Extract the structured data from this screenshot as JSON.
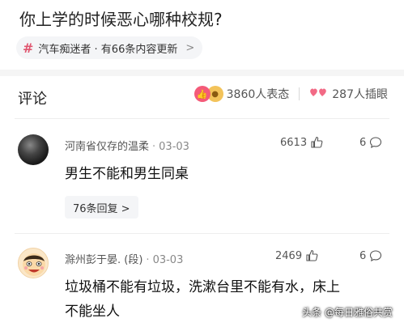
{
  "page": {
    "title": "你上学的时候恶心哪种校规?"
  },
  "topic": {
    "hash_icon": "hash-icon",
    "label": "汽车痴迷者 · 有66条内容更新",
    "chevron": ">"
  },
  "comments_section": {
    "header": "评论",
    "reactions_label": "3860人表态",
    "emoji_label": "287人插眼"
  },
  "comments": [
    {
      "author": "河南省仅存的温柔",
      "date": "03-03",
      "likes": "6613",
      "comment_count": "6",
      "text": "男生不能和男生同桌",
      "replies": "76条回复 >"
    },
    {
      "author": "滁州彭于晏. (段)",
      "date": "03-03",
      "likes": "2469",
      "comment_count": "6",
      "text_line1": "垃圾桶不能有垃圾，洗漱台里不能有水，床上",
      "text_line2": "不能坐人"
    }
  ],
  "watermark": "头条 @每日雅俗共赏",
  "colors": {
    "accent": "#e0566f",
    "chip_bg": "#f4f5f7",
    "divider": "#f5f5f5"
  }
}
